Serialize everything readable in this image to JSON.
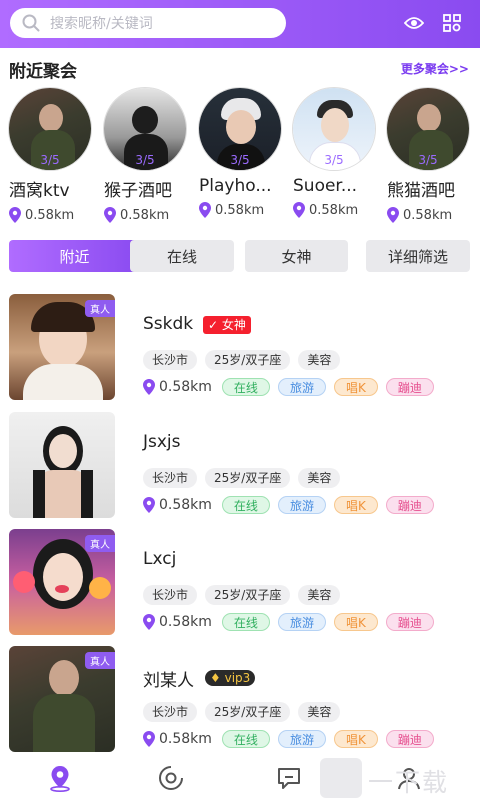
{
  "search": {
    "placeholder": "搜索昵称/关键词"
  },
  "section": {
    "title": "附近聚会",
    "more": "更多聚会>>"
  },
  "parties": [
    {
      "name": "酒窝ktv",
      "count": "3/5",
      "distance": "0.58km"
    },
    {
      "name": "猴子酒吧",
      "count": "3/5",
      "distance": "0.58km"
    },
    {
      "name": "Playho...",
      "count": "3/5",
      "distance": "0.58km"
    },
    {
      "name": "Suoer...",
      "count": "3/5",
      "distance": "0.58km"
    },
    {
      "name": "熊猫酒吧",
      "count": "3/5",
      "distance": "0.58km"
    }
  ],
  "tabs": [
    "附近",
    "在线",
    "女神",
    "详细筛选"
  ],
  "users": [
    {
      "name": "Sskdk",
      "badge": "女神",
      "real": "真人",
      "city": "长沙市",
      "age": "25岁/双子座",
      "job": "美容",
      "distance": "0.58km",
      "tags": [
        "在线",
        "旅游",
        "唱K",
        "蹦迪"
      ]
    },
    {
      "name": "Jsxjs",
      "badge": "",
      "real": "",
      "city": "长沙市",
      "age": "25岁/双子座",
      "job": "美容",
      "distance": "0.58km",
      "tags": [
        "在线",
        "旅游",
        "唱K",
        "蹦迪"
      ]
    },
    {
      "name": "Lxcj",
      "badge": "",
      "real": "真人",
      "city": "长沙市",
      "age": "25岁/双子座",
      "job": "美容",
      "distance": "0.58km",
      "tags": [
        "在线",
        "旅游",
        "唱K",
        "蹦迪"
      ]
    },
    {
      "name": "刘某人",
      "badge": "vip3",
      "real": "真人",
      "city": "长沙市",
      "age": "25岁/双子座",
      "job": "美容",
      "distance": "0.58km",
      "tags": [
        "在线",
        "旅游",
        "唱K",
        "蹦迪"
      ]
    }
  ],
  "watermark": "一下载",
  "colors": {
    "accent": "#8a4bf0",
    "accent_light": "#b06cff",
    "goddess_badge": "#f5202e"
  }
}
